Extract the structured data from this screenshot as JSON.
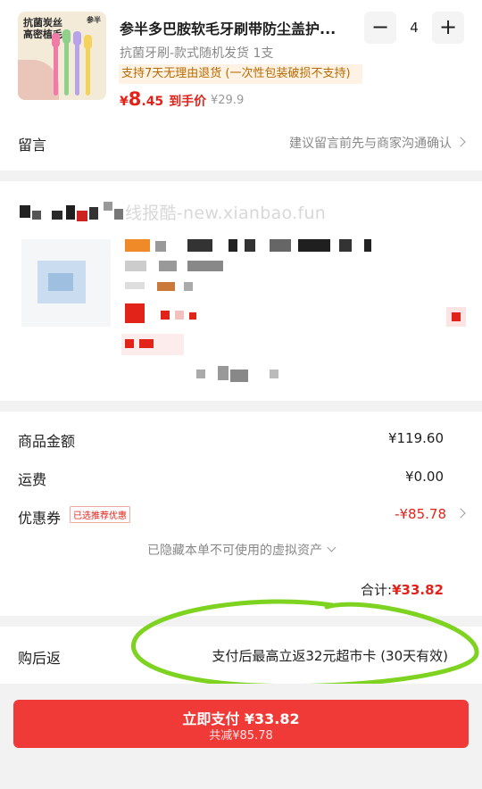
{
  "product": {
    "thumb_tag_line1": "抗菌炭丝",
    "thumb_tag_line2": "高密植毛",
    "thumb_brand": "参半",
    "title": "参半多巴胺软毛牙刷带防尘盖护...",
    "spec": "抗菌牙刷-款式随机发货 1支",
    "policy": "支持7天无理由退货 (一次性包装破损不支持)",
    "price_symbol": "¥",
    "price_int": "8",
    "price_dec": ".45",
    "price_label": "到手价",
    "original_price": "¥29.9",
    "quantity": "4",
    "minus": "−",
    "plus": "+"
  },
  "message": {
    "label": "留言",
    "hint": "建议留言前先与商家沟通确认"
  },
  "watermark": "线报酷-new.xianbao.fun",
  "summary": {
    "goods_label": "商品金额",
    "goods_value": "¥119.60",
    "shipping_label": "运费",
    "shipping_value": "¥0.00",
    "coupon_label": "优惠券",
    "coupon_badge": "已选推荐优惠",
    "coupon_value": "-¥85.78",
    "hidden_note": "已隐藏本单不可使用的虚拟资产",
    "total_label": "合计:",
    "total_value": "¥33.82"
  },
  "rebate": {
    "label": "购后返",
    "text": "支付后最高立返32元超市卡 (30天有效)"
  },
  "pay": {
    "label": "立即支付 ¥33.82",
    "sub": "共减¥85.78"
  },
  "colors": {
    "accent": "#e2231a",
    "pay_button": "#f03a38",
    "highlight_circle": "#7ed321"
  }
}
